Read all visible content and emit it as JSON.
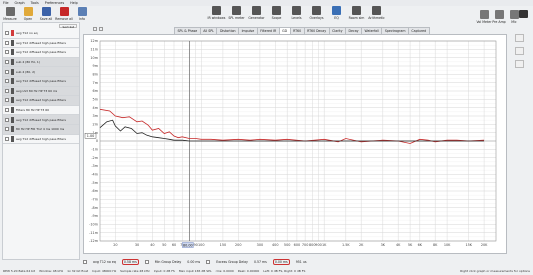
{
  "menubar": [
    "File",
    "Graph",
    "Tools",
    "Preferences",
    "Help"
  ],
  "toolbar_left": [
    {
      "label": "Measure",
      "icon": "microphone-icon",
      "color": "#6a6a6a"
    },
    {
      "label": "Open",
      "icon": "folder-open-icon",
      "color": "#e0a93a"
    },
    {
      "label": "Save all",
      "icon": "save-icon",
      "color": "#3b62a8"
    },
    {
      "label": "Remove all",
      "icon": "remove-icon",
      "color": "#c62828"
    },
    {
      "label": "Info",
      "icon": "info-icon",
      "color": "#5b7fb5"
    }
  ],
  "toolbar_center": [
    {
      "label": "IR windows",
      "icon": "ir-windows-icon",
      "color": "#555"
    },
    {
      "label": "SPL meter",
      "icon": "spl-meter-icon",
      "color": "#555"
    },
    {
      "label": "Generator",
      "icon": "generator-icon",
      "color": "#555"
    },
    {
      "label": "Scope",
      "icon": "scope-icon",
      "color": "#555"
    },
    {
      "label": "Levels",
      "icon": "levels-icon",
      "color": "#555"
    },
    {
      "label": "Overlays",
      "icon": "overlays-icon",
      "color": "#555"
    },
    {
      "label": "EQ",
      "icon": "eq-icon",
      "color": "#3a6fb5"
    },
    {
      "label": "Room sim",
      "icon": "room-sim-icon",
      "color": "#555"
    },
    {
      "label": "Arithmetic",
      "icon": "arithmetic-icon",
      "color": "#555"
    }
  ],
  "toolbar_right": [
    {
      "label": "Vol Meter",
      "icon": "vol-meter-icon"
    },
    {
      "label": "Pre Amp",
      "icon": "pre-amp-icon"
    },
    {
      "label": "Mic",
      "icon": "mic-icon"
    }
  ],
  "left_panel": {
    "header_button": "Sort list",
    "measurements": [
      {
        "name": "avg T12 no eq",
        "color": "#d23a3a",
        "selected": false
      },
      {
        "name": "avg T12 diffused high pass filters",
        "color": "#555555",
        "selected": false
      },
      {
        "name": "avg T12 diffused high pass filters",
        "color": "#555555",
        "selected": false
      },
      {
        "name": "sub 4 (80 Hz, 1)",
        "color": "#555555",
        "selected": true
      },
      {
        "name": "sub 4 (80, 2)",
        "color": "#555555",
        "selected": true
      },
      {
        "name": "avg T12 diffused high pass filters",
        "color": "#555555",
        "selected": true
      },
      {
        "name": "avg LS3 80 Hz HP T3 60 ms",
        "color": "#555555",
        "selected": true
      },
      {
        "name": "avg T12 diffused high pass filters",
        "color": "#555555",
        "selected": true
      },
      {
        "name": "Filters 80 Hz HP T3 60",
        "color": "#555555",
        "selected": false
      },
      {
        "name": "avg T12 diffused high pass filters",
        "color": "#555555",
        "selected": true
      },
      {
        "name": "80 Hz HP FIR T12 4 ms 1000 ms",
        "color": "#555555",
        "selected": true
      },
      {
        "name": "avg T12 diffused high pass filters",
        "color": "#555555",
        "selected": false
      }
    ]
  },
  "tabs": [
    "SPL & Phase",
    "All SPL",
    "Distortion",
    "Impulse",
    "Filtered IR",
    "GD",
    "RT60",
    "RT60 Decay",
    "Clarity",
    "Decay",
    "Waterfall",
    "Spectrogram",
    "Captured"
  ],
  "active_tab": "GD",
  "bottom_bar": {
    "trace1_label": "avg T12 no eq",
    "trace1_value": "0.58 ms",
    "trace2_label": "Min Group Delay",
    "trace2_value": "0.00 ms",
    "trace3_label": "Excess Group Delay",
    "trace3_value": "0.57 ms",
    "cursor_label": "0.00 ms",
    "cursor_value": "951 us"
  },
  "status_bar": {
    "left": "REW 5.20 Beta 64 bit",
    "items": [
      "Window: 48 kHz",
      "1x 32 bit float",
      "Input: 48000 Hz",
      "Sample rate 48 kHz",
      "Input: 0 dB FS",
      "Max input 165 dB SPL",
      "rms: 0.0000",
      "Peak: 0.00000",
      "Left: 0 dB FS, Right: 0 dB FS"
    ],
    "right": "Right click graph or measurements for options"
  },
  "chart_data": {
    "type": "line",
    "title": "",
    "xlabel": "Frequency (Hz)",
    "ylabel": "",
    "x_scale": "log",
    "xlim": [
      15,
      25000
    ],
    "ylim": [
      -12,
      12
    ],
    "unit": "ms",
    "x_ticks": [
      20,
      30,
      40,
      50,
      60,
      70,
      80,
      90,
      100,
      150,
      200,
      300,
      400,
      500,
      600,
      700,
      800,
      900,
      1000,
      1500,
      2000,
      3000,
      4000,
      5000,
      6000,
      8000,
      10000,
      15000,
      20000
    ],
    "x_tick_labels": [
      "20",
      "30",
      "40",
      "50",
      "60",
      "70",
      "80",
      "90",
      "100",
      "150",
      "200",
      "300",
      "400",
      "500",
      "600",
      "700",
      "800",
      "900",
      "1K",
      "1.5K",
      "2K",
      "3K",
      "4K",
      "5K",
      "6K",
      "8K",
      "10K",
      "15K",
      "20K"
    ],
    "y_ticks": [
      12,
      11,
      10,
      9,
      8,
      7,
      6,
      5,
      4,
      3,
      2,
      1,
      0,
      -1,
      -2,
      -3,
      -4,
      -5,
      -6,
      -7,
      -8,
      -9,
      -10,
      -11,
      -12
    ],
    "y_tick_labels": [
      "12m",
      "11m",
      "10m",
      "9m",
      "8m",
      "7m",
      "6m",
      "5m",
      "4m",
      "3m",
      "2m",
      "1m",
      "0",
      "-1m",
      "-2m",
      "-3m",
      "-4m",
      "-5m",
      "-6m",
      "-7m",
      "-8m",
      "-9m",
      "-10m",
      "-11m",
      "-12m"
    ],
    "grid": true,
    "vertical_marker_x": 80,
    "vertical_marker_label": "80.00",
    "cursor_y_label": "1.00",
    "series": [
      {
        "name": "avg T12 no eq",
        "color": "#c62828",
        "x": [
          15,
          18,
          20,
          23,
          26,
          30,
          33,
          37,
          40,
          45,
          50,
          55,
          60,
          65,
          70,
          80,
          90,
          100,
          120,
          150,
          200,
          250,
          300,
          400,
          500,
          700,
          1000,
          1300,
          1500,
          2000,
          3000,
          4000,
          5000,
          6000,
          7000,
          8000,
          10000,
          12000,
          15000,
          20000
        ],
        "y": [
          3.8,
          3.6,
          3.0,
          2.8,
          2.9,
          2.3,
          2.4,
          1.9,
          1.3,
          1.5,
          0.9,
          1.1,
          0.6,
          0.4,
          0.5,
          0.3,
          0.3,
          0.2,
          0.2,
          0.1,
          0.2,
          0.1,
          0.2,
          0.1,
          0.2,
          0.0,
          0.2,
          -0.1,
          0.3,
          -0.1,
          0.1,
          0.0,
          -0.3,
          0.2,
          0.1,
          -0.1,
          0.1,
          0.1,
          0.0,
          0.1
        ]
      },
      {
        "name": "",
        "color": "#222222",
        "x": [
          15,
          17,
          19,
          20,
          22,
          24,
          27,
          30,
          33,
          36,
          40,
          45,
          50,
          55,
          60,
          70,
          80,
          100,
          150,
          200,
          300,
          500,
          1000,
          2000,
          5000,
          10000,
          20000
        ],
        "y": [
          1.6,
          2.3,
          2.5,
          1.8,
          1.2,
          1.7,
          1.5,
          0.9,
          1.0,
          0.7,
          0.5,
          0.4,
          0.3,
          0.2,
          0.1,
          0.1,
          0.0,
          0.0,
          0.0,
          0.0,
          0.0,
          0.0,
          0.0,
          0.0,
          0.0,
          0.0,
          0.0
        ]
      }
    ]
  }
}
